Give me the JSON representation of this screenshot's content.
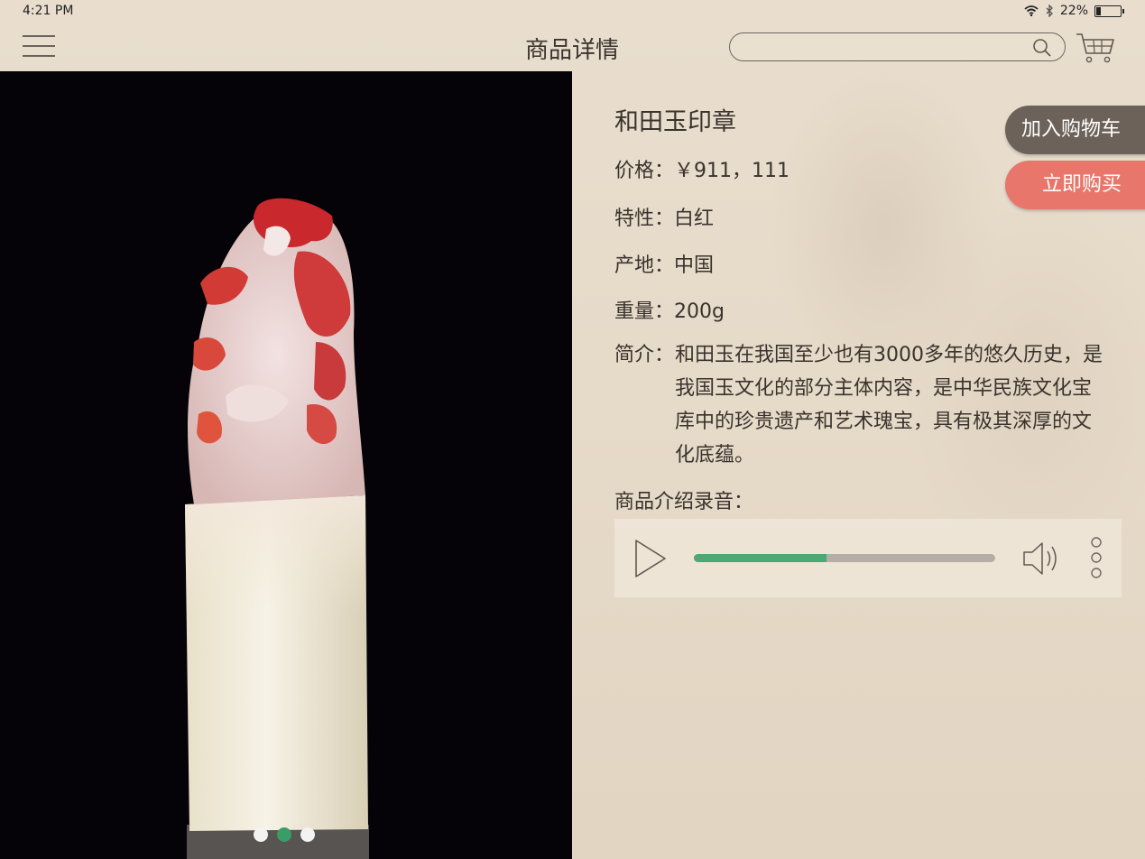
{
  "status": {
    "time": "4:21 PM",
    "battery": "22%",
    "battery_level": 0.22
  },
  "header": {
    "title": "商品详情",
    "search_placeholder": ""
  },
  "product": {
    "name": "和田玉印章",
    "price_label": "价格：",
    "price_value": "￥911，111",
    "feature_label": "特性：",
    "feature_value": "白红",
    "origin_label": "产地：",
    "origin_value": "中国",
    "weight_label": "重量：",
    "weight_value": "200g",
    "intro_label": "简介：",
    "intro_value": "和田玉在我国至少也有3000多年的悠久历史，是我国玉文化的部分主体内容，是中华民族文化宝库中的珍贵遗产和艺术瑰宝，具有极其深厚的文化底蕴。"
  },
  "actions": {
    "add_to_cart": "加入购物车",
    "buy_now": "立即购买"
  },
  "audio": {
    "label": "商品介绍录音：",
    "progress": 0.44
  },
  "gallery": {
    "image_count": 3,
    "active_index": 1
  },
  "colors": {
    "accent_green": "#4da876",
    "buy_red": "#e8766a",
    "cart_gray": "#6c625a",
    "image_bg": "#050308"
  }
}
